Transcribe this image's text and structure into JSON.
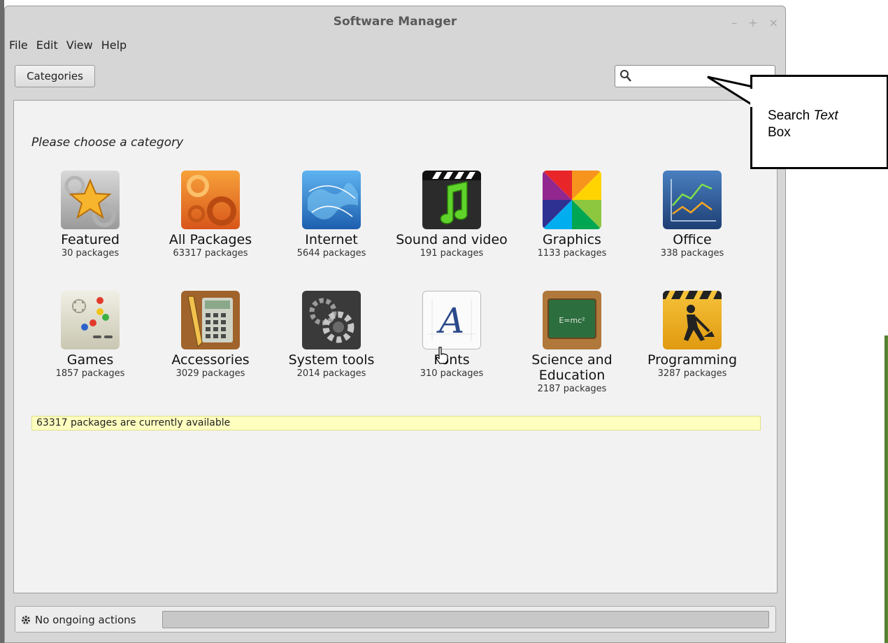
{
  "window": {
    "title": "Software Manager",
    "controls": {
      "minimize": "–",
      "maximize": "+",
      "close": "×"
    }
  },
  "menu": [
    "File",
    "Edit",
    "View",
    "Help"
  ],
  "toolbar": {
    "categories_label": "Categories"
  },
  "search": {
    "value": "",
    "placeholder": ""
  },
  "heading": "Please choose a category",
  "categories": [
    {
      "name": "Featured",
      "count": "30 packages",
      "icon": "featured-star-icon"
    },
    {
      "name": "All Packages",
      "count": "63317 packages",
      "icon": "all-packages-gears-icon"
    },
    {
      "name": "Internet",
      "count": "5644 packages",
      "icon": "internet-globe-icon"
    },
    {
      "name": "Sound and video",
      "count": "191 packages",
      "icon": "sound-video-clapper-icon"
    },
    {
      "name": "Graphics",
      "count": "1133 packages",
      "icon": "graphics-color-wheel-icon"
    },
    {
      "name": "Office",
      "count": "338 packages",
      "icon": "office-chart-icon"
    },
    {
      "name": "Games",
      "count": "1857 packages",
      "icon": "games-controller-icon"
    },
    {
      "name": "Accessories",
      "count": "3029 packages",
      "icon": "accessories-calculator-icon"
    },
    {
      "name": "System tools",
      "count": "2014 packages",
      "icon": "system-tools-gear-icon"
    },
    {
      "name": "Fonts",
      "count": "310 packages",
      "icon": "fonts-letter-icon"
    },
    {
      "name": "Science and Education",
      "count": "2187 packages",
      "icon": "science-chalkboard-icon"
    },
    {
      "name": "Programming",
      "count": "3287 packages",
      "icon": "programming-worker-icon"
    }
  ],
  "status_message": "63317 packages are currently available",
  "footer": {
    "actions_label": "No ongoing actions",
    "progress": 0
  },
  "callout": {
    "line1_plain": "Search ",
    "line1_italic": "Text",
    "line2": "Box"
  }
}
